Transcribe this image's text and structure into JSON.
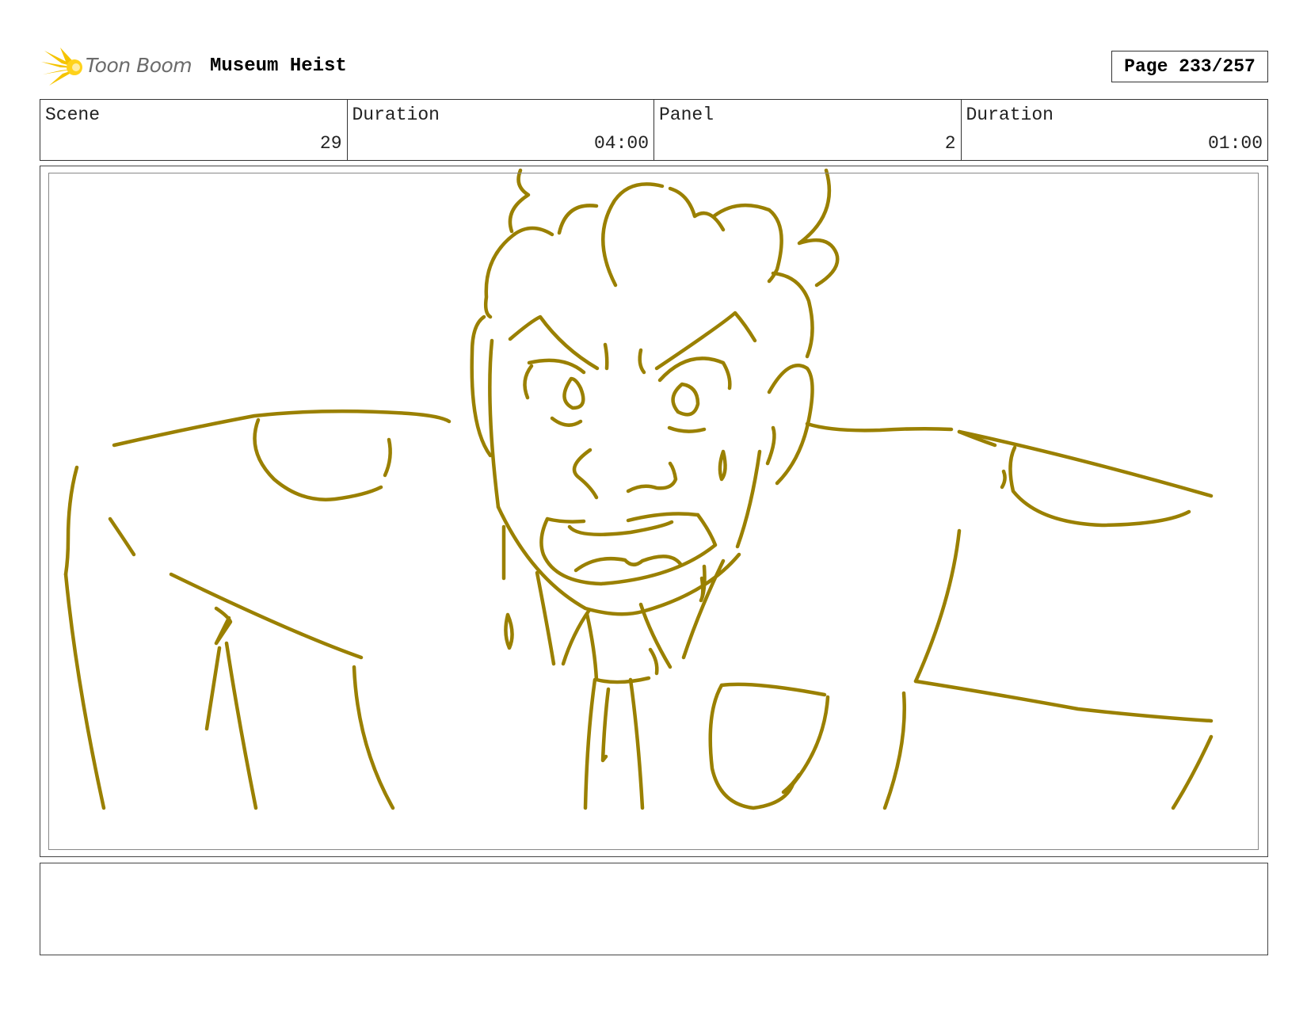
{
  "header": {
    "logo_text": "Toon Boom",
    "project_title": "Museum Heist",
    "page_indicator": "Page 233/257"
  },
  "info": {
    "scene_label": "Scene",
    "scene_value": "29",
    "scene_duration_label": "Duration",
    "scene_duration_value": "04:00",
    "panel_label": "Panel",
    "panel_value": "2",
    "panel_duration_label": "Duration",
    "panel_duration_value": "01:00"
  },
  "colors": {
    "sketch_line": "#9a8000",
    "logo_star": "#f5c400"
  },
  "notes": {
    "text": ""
  }
}
